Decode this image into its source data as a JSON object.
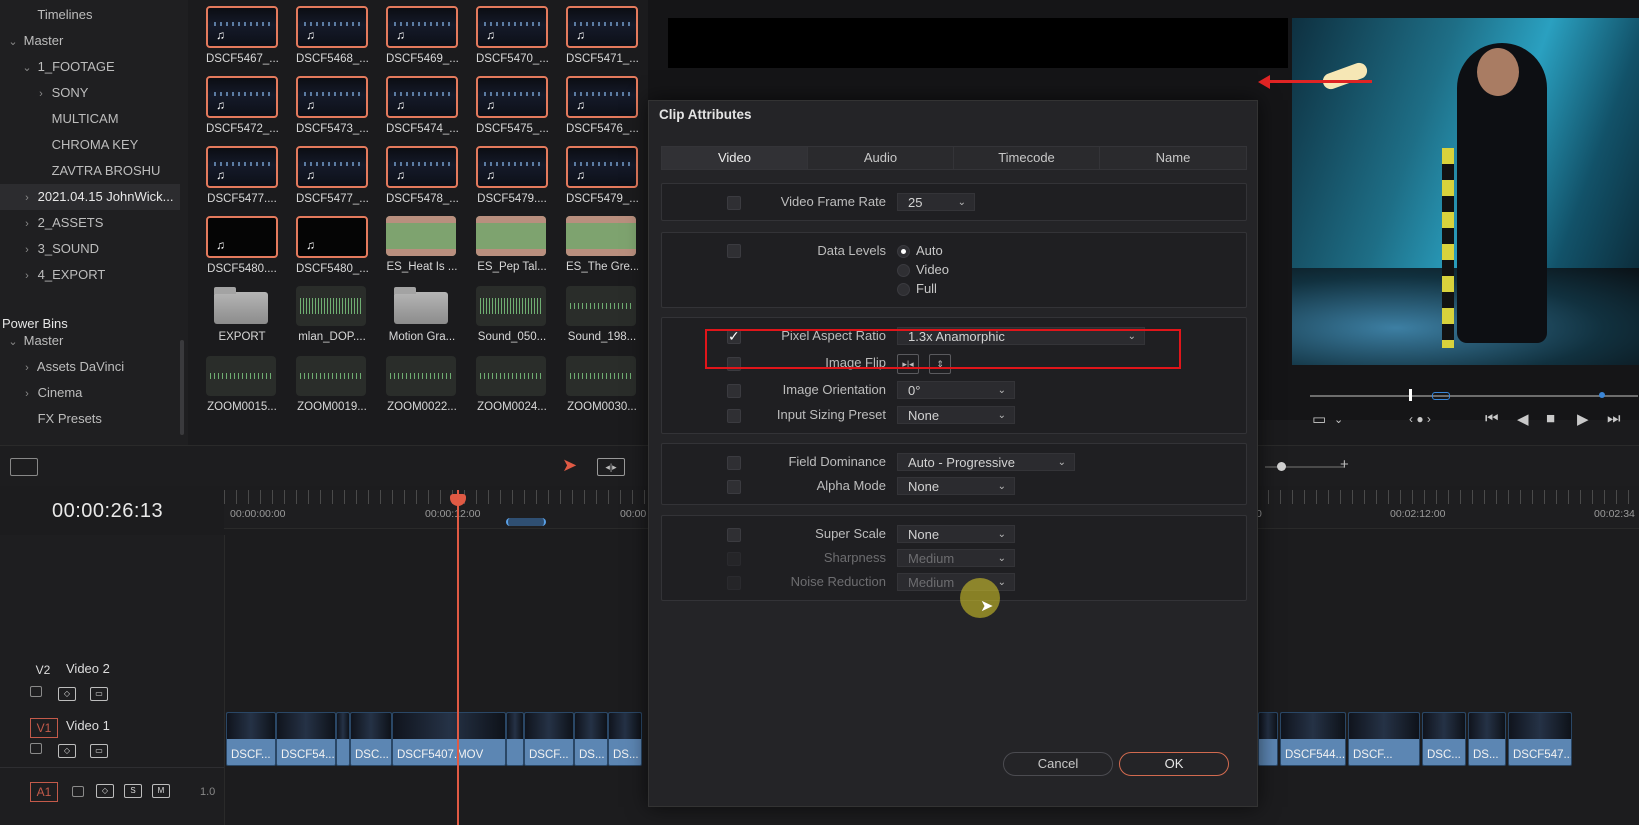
{
  "bin_tree": {
    "rows": [
      {
        "label": "Timelines",
        "indent": 1,
        "chevron": ""
      },
      {
        "label": "Master",
        "indent": 0,
        "chevron": "⌄"
      },
      {
        "label": "1_FOOTAGE",
        "indent": 1,
        "chevron": "⌄"
      },
      {
        "label": "SONY",
        "indent": 2,
        "chevron": "›"
      },
      {
        "label": "MULTICAM",
        "indent": 2,
        "chevron": ""
      },
      {
        "label": "CHROMA KEY",
        "indent": 2,
        "chevron": ""
      },
      {
        "label": "ZAVTRA BROSHU",
        "indent": 2,
        "chevron": ""
      },
      {
        "label": "2021.04.15 JohnWick...",
        "indent": 1,
        "chevron": "›",
        "selected": true
      },
      {
        "label": "2_ASSETS",
        "indent": 1,
        "chevron": "›"
      },
      {
        "label": "3_SOUND",
        "indent": 1,
        "chevron": "›"
      },
      {
        "label": "4_EXPORT",
        "indent": 1,
        "chevron": "›"
      }
    ],
    "power_bins_label": "Power Bins",
    "power_rows": [
      {
        "label": "Master",
        "indent": 0,
        "chevron": "⌄"
      },
      {
        "label": "Assets DaVinci",
        "indent": 1,
        "chevron": "›"
      },
      {
        "label": "Cinema",
        "indent": 1,
        "chevron": "›"
      },
      {
        "label": "FX Presets",
        "indent": 1,
        "chevron": ""
      }
    ]
  },
  "media_pool": {
    "clips": [
      {
        "name": "DSCF5467_...",
        "kind": "night",
        "selected": true,
        "note": true
      },
      {
        "name": "DSCF5468_...",
        "kind": "night",
        "selected": true,
        "note": true
      },
      {
        "name": "DSCF5469_...",
        "kind": "night",
        "selected": true,
        "note": true
      },
      {
        "name": "DSCF5470_...",
        "kind": "night",
        "selected": true,
        "note": true
      },
      {
        "name": "DSCF5471_...",
        "kind": "night",
        "selected": true,
        "note": true
      },
      {
        "name": "DSCF5472_...",
        "kind": "night",
        "selected": true,
        "note": true
      },
      {
        "name": "DSCF5473_...",
        "kind": "night",
        "selected": true,
        "note": true
      },
      {
        "name": "DSCF5474_...",
        "kind": "night",
        "selected": true,
        "note": true
      },
      {
        "name": "DSCF5475_...",
        "kind": "night",
        "selected": true,
        "note": true
      },
      {
        "name": "DSCF5476_...",
        "kind": "night",
        "selected": true,
        "note": true
      },
      {
        "name": "DSCF5477....",
        "kind": "night",
        "selected": true,
        "note": true
      },
      {
        "name": "DSCF5477_...",
        "kind": "night",
        "selected": true,
        "note": true
      },
      {
        "name": "DSCF5478_...",
        "kind": "night",
        "selected": true,
        "note": true
      },
      {
        "name": "DSCF5479....",
        "kind": "night",
        "selected": true,
        "note": true
      },
      {
        "name": "DSCF5479_...",
        "kind": "night",
        "selected": true,
        "note": true
      },
      {
        "name": "DSCF5480....",
        "kind": "black",
        "selected": true,
        "note": true
      },
      {
        "name": "DSCF5480_...",
        "kind": "black",
        "selected": true,
        "note": true
      },
      {
        "name": "ES_Heat Is ...",
        "kind": "audio-green"
      },
      {
        "name": "ES_Pep Tal...",
        "kind": "audio-green"
      },
      {
        "name": "ES_The Gre...",
        "kind": "audio-green"
      },
      {
        "name": "EXPORT",
        "kind": "folder"
      },
      {
        "name": "mlan_DOP....",
        "kind": "audio-wave"
      },
      {
        "name": "Motion Gra...",
        "kind": "folder"
      },
      {
        "name": "Sound_050...",
        "kind": "audio-wave"
      },
      {
        "name": "Sound_198...",
        "kind": "audio-thin"
      },
      {
        "name": "ZOOM0015...",
        "kind": "audio-thin"
      },
      {
        "name": "ZOOM0019...",
        "kind": "audio-thin"
      },
      {
        "name": "ZOOM0022...",
        "kind": "audio-thin"
      },
      {
        "name": "ZOOM0024...",
        "kind": "audio-thin"
      },
      {
        "name": "ZOOM0030...",
        "kind": "audio-thin"
      }
    ]
  },
  "timeline": {
    "timecode": "00:00:26:13",
    "ruler_labels": [
      {
        "text": "00:00:00:00",
        "time_s": 0
      },
      {
        "text": "00:00:12:00",
        "time_s": 12
      },
      {
        "text": "00:00:12:00",
        "time_s": 132,
        "display": "00:02:12:00"
      }
    ],
    "ruler_start": "00:00:00:00",
    "ruler_mid": "00:00:12:00",
    "ruler_cut": "00:00",
    "ruler_right1": "00:02:12:00",
    "ruler_right2": "00:02:34",
    "ruler_right0": "0",
    "tracks": {
      "v2": {
        "tag": "V2",
        "name": "Video 2"
      },
      "v1": {
        "tag": "V1",
        "name": "Video 1"
      },
      "a1": {
        "tag": "A1",
        "s": "S",
        "m": "M",
        "level": "1.0"
      }
    },
    "clips_left": [
      {
        "label": "DSCF..."
      },
      {
        "label": "DSCF54..."
      },
      {
        "label": ""
      },
      {
        "label": "DSC..."
      },
      {
        "label": "DSCF5407.MOV"
      },
      {
        "label": ""
      },
      {
        "label": "DSCF..."
      },
      {
        "label": "DS..."
      },
      {
        "label": "DS..."
      }
    ],
    "clips_right": [
      {
        "label": ""
      },
      {
        "label": "DSCF544..."
      },
      {
        "label": "DSCF..."
      },
      {
        "label": "DSC..."
      },
      {
        "label": "DS..."
      },
      {
        "label": "DSCF547..."
      }
    ]
  },
  "dialog": {
    "title": "Clip Attributes",
    "tabs": [
      "Video",
      "Audio",
      "Timecode",
      "Name"
    ],
    "active_tab": "Video",
    "video_frame_rate": {
      "label": "Video Frame Rate",
      "value": "25"
    },
    "data_levels": {
      "label": "Data Levels",
      "options": [
        "Auto",
        "Video",
        "Full"
      ],
      "selected": "Auto"
    },
    "pixel_aspect_ratio": {
      "label": "Pixel Aspect Ratio",
      "value": "1.3x Anamorphic",
      "checked": true
    },
    "image_flip": {
      "label": "Image Flip"
    },
    "image_orientation": {
      "label": "Image Orientation",
      "value": "0°"
    },
    "input_sizing_preset": {
      "label": "Input Sizing Preset",
      "value": "None"
    },
    "field_dominance": {
      "label": "Field Dominance",
      "value": "Auto - Progressive"
    },
    "alpha_mode": {
      "label": "Alpha Mode",
      "value": "None"
    },
    "super_scale": {
      "label": "Super Scale",
      "value": "None"
    },
    "sharpness": {
      "label": "Sharpness",
      "value": "Medium"
    },
    "noise_reduction": {
      "label": "Noise Reduction",
      "value": "Medium"
    },
    "cancel_label": "Cancel",
    "ok_label": "OK"
  },
  "colors": {
    "accent": "#e47a5d",
    "highlight_box": "#e0151a",
    "playhead": "#e05a44",
    "clip_blue": "#5c86b3"
  },
  "icons": {
    "music_note": "♫",
    "checkmark": "✓",
    "chevron_down": "⌄",
    "chevron_right": "›"
  }
}
